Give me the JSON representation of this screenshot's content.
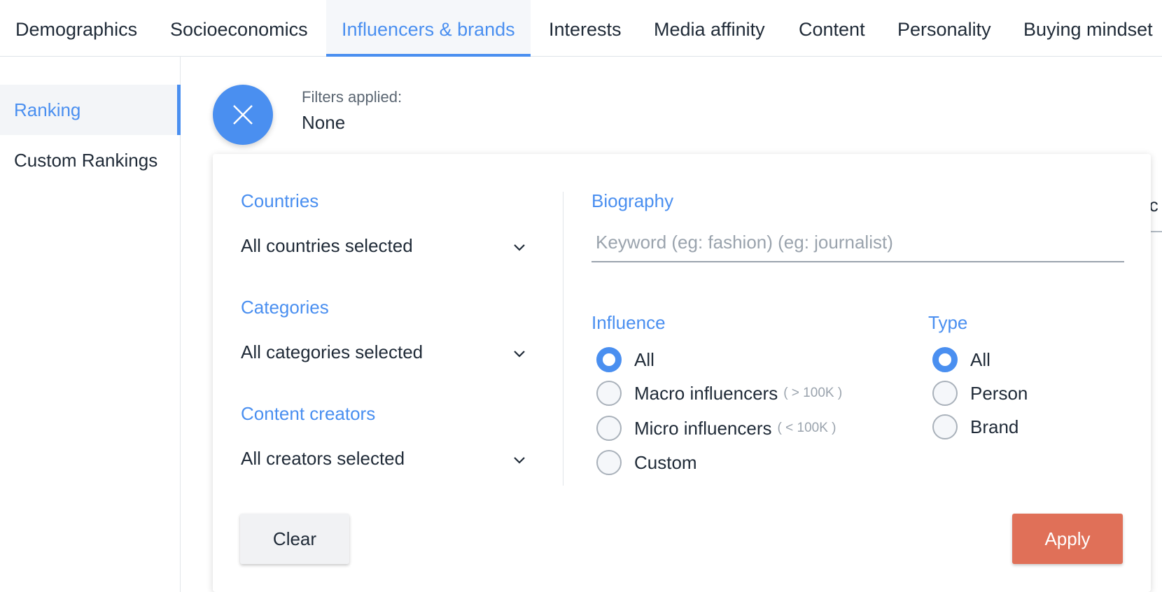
{
  "tabs": [
    {
      "label": "Demographics",
      "active": false
    },
    {
      "label": "Socioeconomics",
      "active": false
    },
    {
      "label": "Influencers & brands",
      "active": true
    },
    {
      "label": "Interests",
      "active": false
    },
    {
      "label": "Media affinity",
      "active": false
    },
    {
      "label": "Content",
      "active": false
    },
    {
      "label": "Personality",
      "active": false
    },
    {
      "label": "Buying mindset",
      "active": false
    }
  ],
  "sidebar": {
    "items": [
      {
        "label": "Ranking",
        "active": true
      },
      {
        "label": "Custom Rankings",
        "active": false
      }
    ]
  },
  "header": {
    "close_icon": "close-icon",
    "filters_label": "Filters applied:",
    "filters_value": "None"
  },
  "background": {
    "partial_text": "ic"
  },
  "panel": {
    "countries": {
      "label": "Countries",
      "value": "All countries selected"
    },
    "categories": {
      "label": "Categories",
      "value": "All categories selected"
    },
    "creators": {
      "label": "Content creators",
      "value": "All creators selected"
    },
    "biography": {
      "label": "Biography",
      "placeholder": "Keyword (eg: fashion) (eg: journalist)"
    },
    "influence": {
      "label": "Influence",
      "options": [
        {
          "label": "All",
          "hint": "",
          "checked": true
        },
        {
          "label": "Macro influencers",
          "hint": "( > 100K )",
          "checked": false
        },
        {
          "label": "Micro influencers",
          "hint": "( < 100K )",
          "checked": false
        },
        {
          "label": "Custom",
          "hint": "",
          "checked": false
        }
      ]
    },
    "type": {
      "label": "Type",
      "options": [
        {
          "label": "All",
          "checked": true
        },
        {
          "label": "Person",
          "checked": false
        },
        {
          "label": "Brand",
          "checked": false
        }
      ]
    },
    "clear_label": "Clear",
    "apply_label": "Apply"
  },
  "colors": {
    "accent": "#4a8ff0",
    "apply": "#e07058",
    "text": "#1f2a37",
    "muted": "#9aa3ad"
  }
}
